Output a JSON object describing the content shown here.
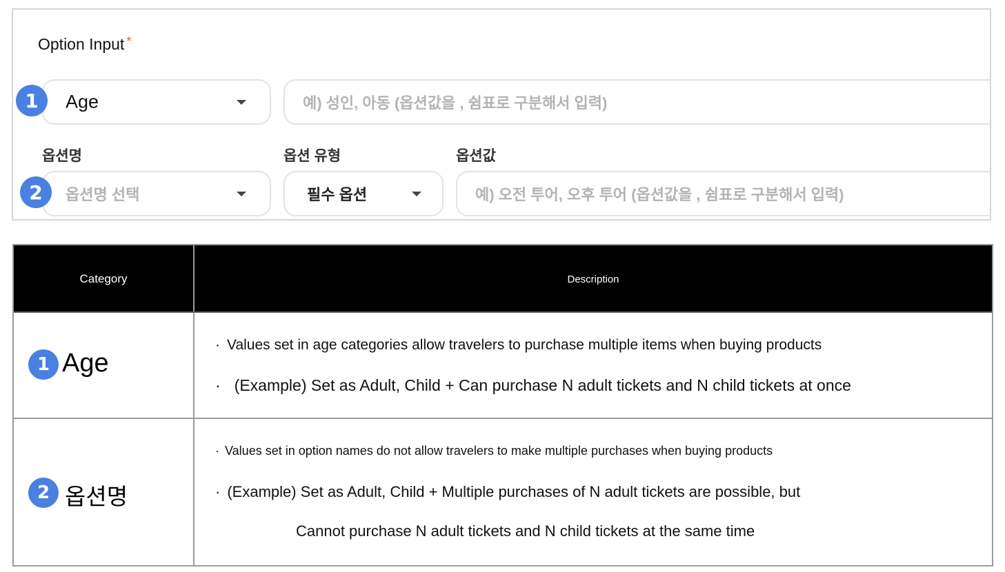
{
  "form": {
    "title": "Option Input",
    "required_mark": "*",
    "row1": {
      "badge": "1",
      "select_value": "Age",
      "input_placeholder": "예) 성인, 아동 (옵션값을 , 쉼표로 구분해서 입력)"
    },
    "row2": {
      "badge": "2",
      "label_name": "옵션명",
      "label_type": "옵션 유형",
      "label_value": "옵션값",
      "name_select_placeholder": "옵션명 선택",
      "type_select_value": "필수 옵션",
      "value_input_placeholder": "예) 오전 투어, 오후 투어 (옵션값을 , 쉼표로 구분해서 입력)"
    }
  },
  "table": {
    "headers": {
      "category": "Category",
      "description": "Description"
    },
    "rows": [
      {
        "badge": "1",
        "category": "Age",
        "lines": [
          "Values set in age categories allow travelers to purchase multiple items when buying products",
          "(Example) Set as Adult, Child + Can purchase N adult tickets and N child tickets at once"
        ]
      },
      {
        "badge": "2",
        "category": "옵션명",
        "lines": [
          "Values set in option names do not allow travelers to make multiple purchases when buying products",
          "(Example) Set as Adult, Child + Multiple purchases of N adult tickets are possible, but",
          "Cannot purchase N adult tickets and N child tickets at the same time"
        ]
      }
    ],
    "bullet": "·"
  },
  "colors": {
    "badge": "#4a80e0",
    "required": "#ff4d4d",
    "header_bg": "#000000",
    "border": "#9a9a9a"
  }
}
